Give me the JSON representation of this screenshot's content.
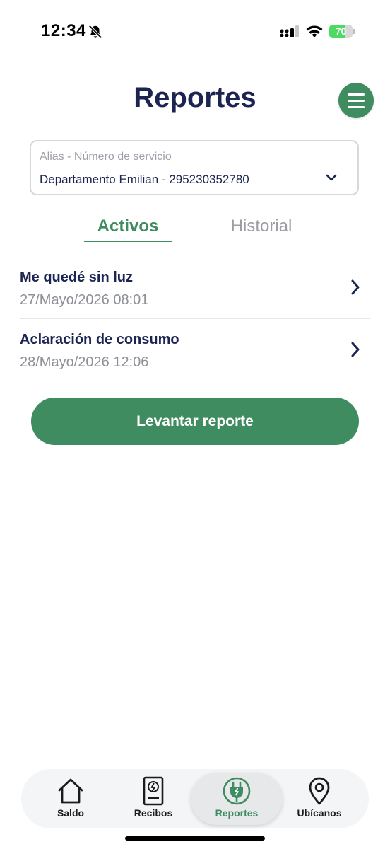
{
  "status_bar": {
    "time": "12:34",
    "battery_text": "70",
    "battery_level_percent": 70
  },
  "header": {
    "title": "Reportes"
  },
  "service_select": {
    "label": "Alias - Número de servicio",
    "value": "Departamento Emilian - 295230352780"
  },
  "tabs": [
    {
      "label": "Activos",
      "active": true
    },
    {
      "label": "Historial",
      "active": false
    }
  ],
  "reports": [
    {
      "title": "Me quedé sin luz",
      "date": "27/Mayo/2026 08:01"
    },
    {
      "title": "Aclaración de consumo",
      "date": "28/Mayo/2026 12:06"
    }
  ],
  "primary_action": {
    "label": "Levantar reporte"
  },
  "bottom_nav": [
    {
      "label": "Saldo",
      "icon": "home-icon",
      "active": false
    },
    {
      "label": "Recibos",
      "icon": "receipt-icon",
      "active": false
    },
    {
      "label": "Reportes",
      "icon": "plug-icon",
      "active": true
    },
    {
      "label": "Ubícanos",
      "icon": "location-pin-icon",
      "active": false
    }
  ],
  "colors": {
    "primary_green": "#3e8c5f",
    "navy_text": "#1c2452",
    "muted_text": "#8e9097"
  }
}
